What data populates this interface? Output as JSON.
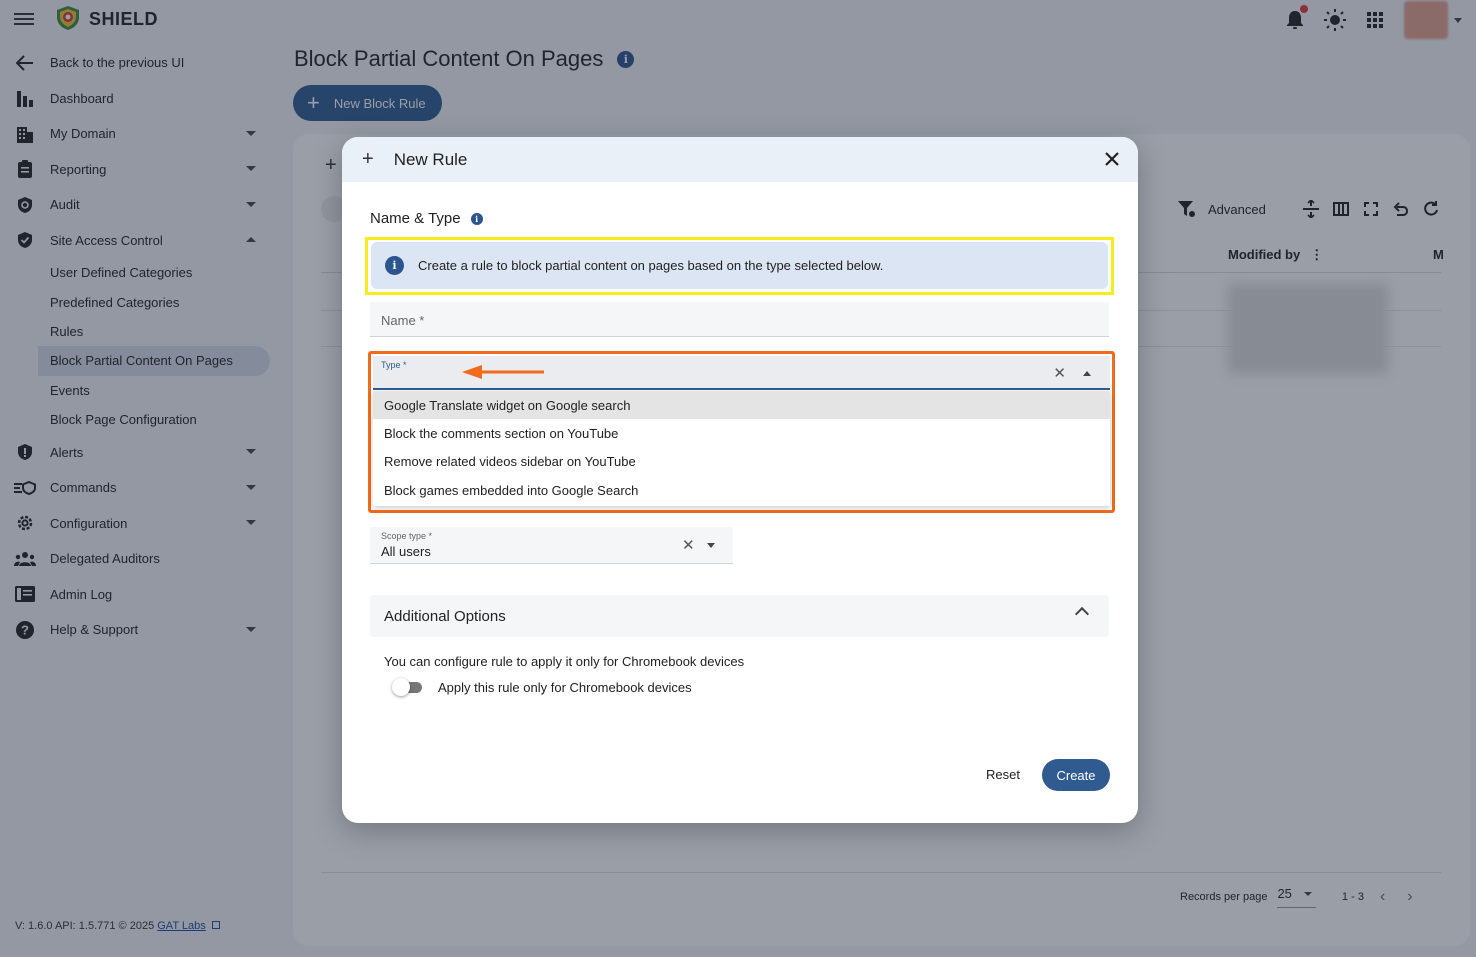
{
  "app": {
    "brand": "SHIELD"
  },
  "sidebar": {
    "items": [
      {
        "label": "Back to the previous UI",
        "icon": "arrow-left-icon"
      },
      {
        "label": "Dashboard",
        "icon": "bar-chart-icon"
      },
      {
        "label": "My Domain",
        "icon": "building-icon",
        "expand": "down"
      },
      {
        "label": "Reporting",
        "icon": "clipboard-icon",
        "expand": "down"
      },
      {
        "label": "Audit",
        "icon": "audit-search-icon",
        "expand": "down"
      },
      {
        "label": "Site Access Control",
        "icon": "shield-check-icon",
        "expand": "up"
      }
    ],
    "sub_items": [
      "User Defined Categories",
      "Predefined Categories",
      "Rules",
      "Block Partial Content On Pages",
      "Events",
      "Block Page Configuration"
    ],
    "active_sub": "Block Partial Content On Pages",
    "items_after": [
      {
        "label": "Alerts",
        "icon": "alert-shield-icon",
        "expand": "down"
      },
      {
        "label": "Commands",
        "icon": "commands-icon",
        "expand": "down"
      },
      {
        "label": "Configuration",
        "icon": "gear-icon",
        "expand": "down"
      },
      {
        "label": "Delegated Auditors",
        "icon": "people-icon"
      },
      {
        "label": "Admin Log",
        "icon": "log-book-icon"
      },
      {
        "label": "Help & Support",
        "icon": "help-icon",
        "expand": "down"
      }
    ],
    "footer": {
      "text": "V: 1.6.0  API: 1.5.771  © 2025 ",
      "link": "GAT Labs"
    }
  },
  "page": {
    "title": "Block Partial Content On Pages",
    "new_button": "New Block Rule",
    "toolbar": {
      "advanced": "Advanced"
    },
    "columns": {
      "modified_by": "Modified by",
      "next_col_initial": "M"
    },
    "pager": {
      "label": "Records per page",
      "per_page": "25",
      "range": "1 - 3"
    }
  },
  "modal": {
    "title": "New Rule",
    "section_title": "Name & Type",
    "info_text": "Create a rule to block partial content on pages based on the type selected below.",
    "name_label": "Name *",
    "type_label": "Type *",
    "type_options": [
      "Google Translate widget on Google search",
      "Block the comments section on YouTube",
      "Remove related videos sidebar on YouTube",
      "Block games embedded into Google Search"
    ],
    "highlighted_option_index": 0,
    "scope_label": "Scope type *",
    "scope_value": "All users",
    "additional_title": "Additional Options",
    "additional_desc": "You can configure rule to apply it only for Chromebook devices",
    "toggle_label": "Apply this rule only for Chromebook devices",
    "toggle_on": false,
    "reset_label": "Reset",
    "create_label": "Create"
  },
  "colors": {
    "primary": "#2f5b91",
    "annotation_yellow": "#f5ee1c",
    "annotation_orange": "#f26a1b",
    "notification_dot": "#e53935"
  }
}
